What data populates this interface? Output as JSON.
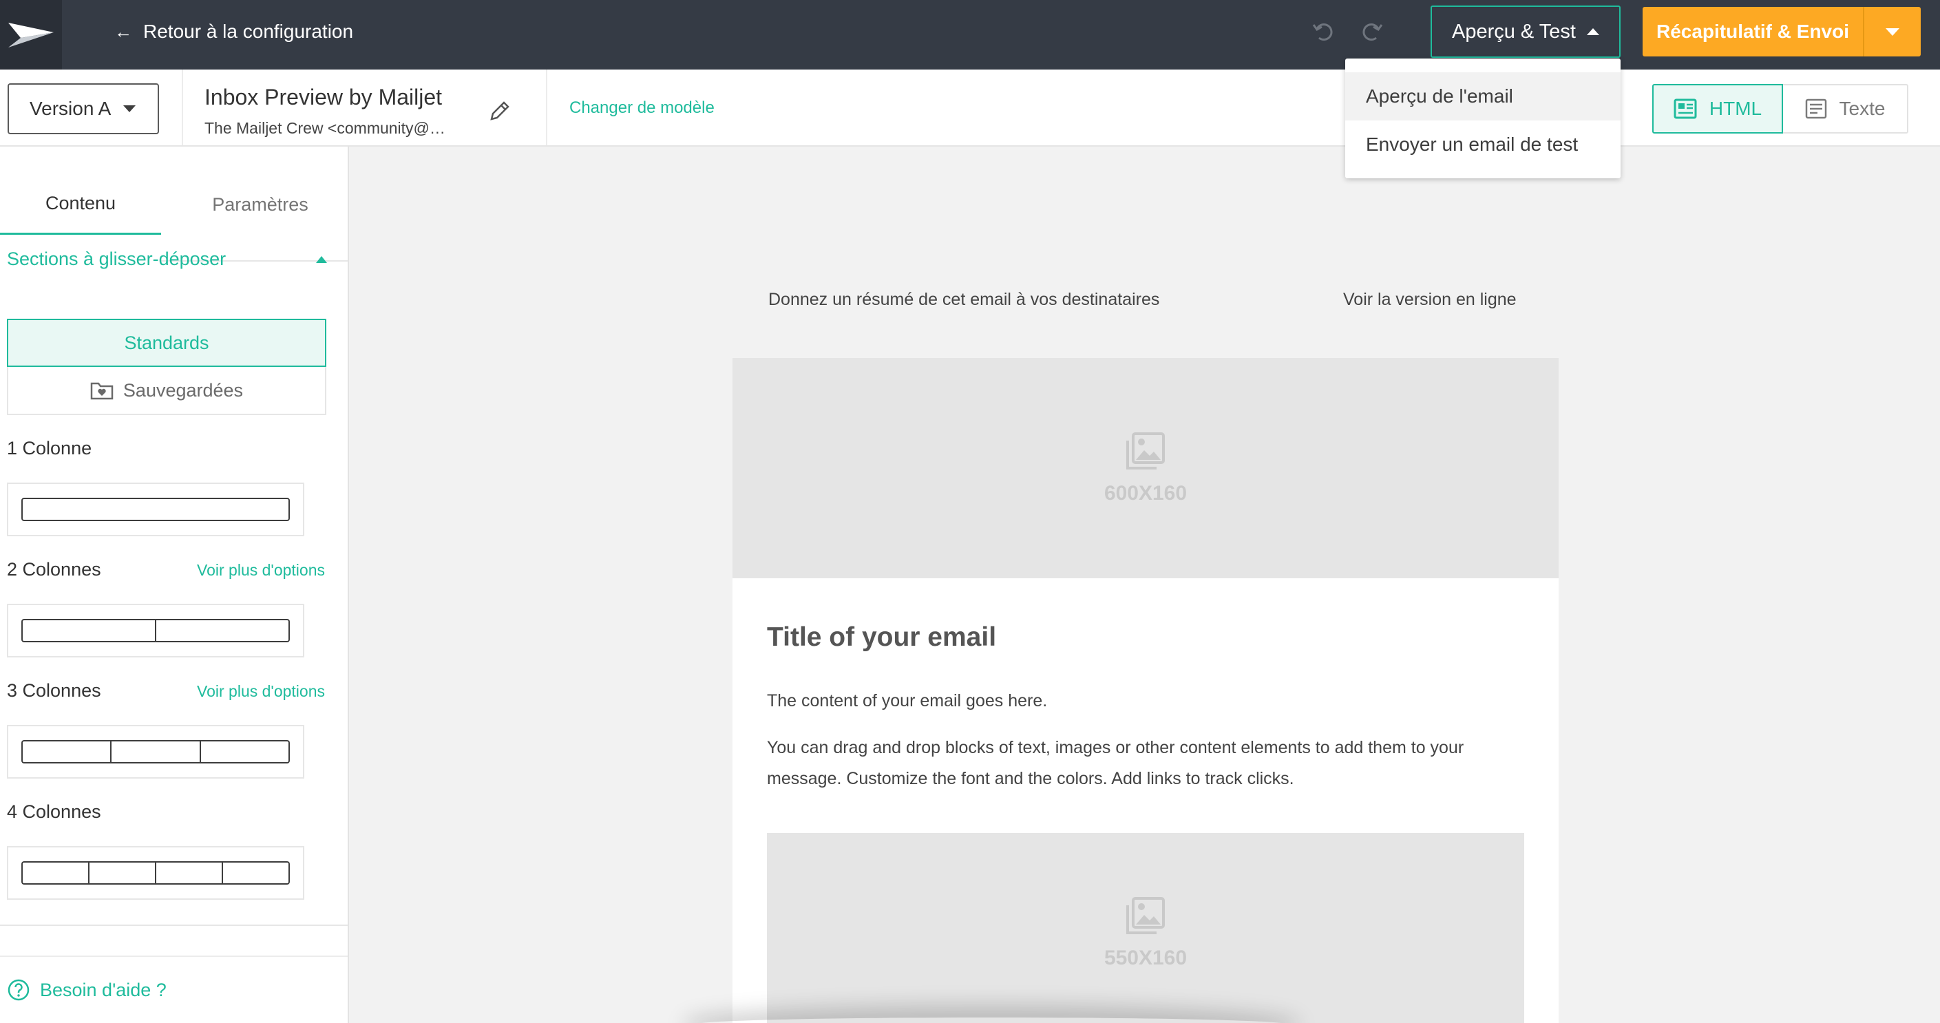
{
  "topbar": {
    "back_label": "Retour à la configuration",
    "preview_test_label": "Aperçu & Test",
    "send_label": "Récapitulatif & Envoi",
    "icons": {
      "logo": "paper-plane-logo",
      "undo": "undo-icon",
      "redo": "redo-icon"
    },
    "colors": {
      "bar": "#353b45",
      "accent": "#1fbb9c",
      "send": "#fda923"
    }
  },
  "subbar": {
    "version_label": "Version A",
    "campaign_title": "Inbox Preview by Mailjet",
    "campaign_sender": "The Mailjet Crew <community@mailjet.com>",
    "change_template_label": "Changer de modèle",
    "html_label": "HTML",
    "text_label": "Texte"
  },
  "menu": {
    "items": [
      {
        "label": "Aperçu de l'email",
        "active": true
      },
      {
        "label": "Envoyer un email de test",
        "active": false
      }
    ]
  },
  "sidebar": {
    "tabs": [
      {
        "label": "Contenu",
        "active": true
      },
      {
        "label": "Paramètres",
        "active": false
      }
    ],
    "section_title": "Sections à glisser-déposer",
    "standards_label": "Standards",
    "saved_label": "Sauvegardées",
    "layouts": [
      {
        "label": "1 Colonne",
        "columns": 1,
        "more": ""
      },
      {
        "label": "2 Colonnes",
        "columns": 2,
        "more": "Voir plus d'options"
      },
      {
        "label": "3 Colonnes",
        "columns": 3,
        "more": "Voir plus d'options"
      },
      {
        "label": "4 Colonnes",
        "columns": 4,
        "more": ""
      }
    ],
    "help_label": "Besoin d'aide ?"
  },
  "email": {
    "preheader": "Donnez un résumé de cet email à vos destinataires",
    "view_online": "Voir la version en ligne",
    "hero_image_label": "600X160",
    "title": "Title of your email",
    "paragraph1": "The content of your email goes here.",
    "paragraph2": "You can drag and drop blocks of text, images or other content elements to add them to your message. Customize the font and the colors. Add links to track clicks.",
    "second_image_label": "550X160"
  }
}
